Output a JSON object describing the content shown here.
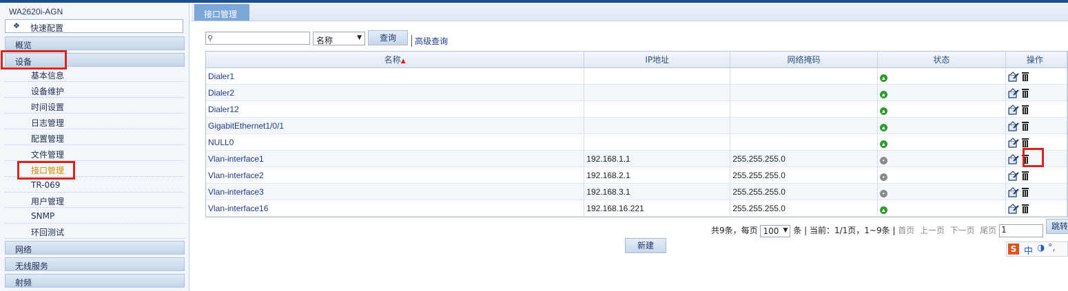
{
  "device_model": "WA2620i-AGN",
  "sidebar": {
    "quick_config": "快速配置",
    "sections_top": [
      "概览",
      "设备"
    ],
    "device_items": [
      "基本信息",
      "设备维护",
      "时间设置",
      "日志管理",
      "配置管理",
      "文件管理",
      "接口管理",
      "TR-069",
      "用户管理",
      "SNMP",
      "环回测试"
    ],
    "active_item": "接口管理",
    "sections_bottom": [
      "网络",
      "无线服务",
      "射频"
    ]
  },
  "tab": {
    "label": "接口管理"
  },
  "search": {
    "field_value": "名称",
    "query_button": "查询",
    "advanced_link": "高级查询"
  },
  "table": {
    "columns": [
      "名称",
      "IP地址",
      "网络掩码",
      "状态",
      "操作"
    ],
    "rows": [
      {
        "name": "Dialer1",
        "ip": "",
        "mask": "",
        "status": "up"
      },
      {
        "name": "Dialer2",
        "ip": "",
        "mask": "",
        "status": "up"
      },
      {
        "name": "Dialer12",
        "ip": "",
        "mask": "",
        "status": "up"
      },
      {
        "name": "GigabitEthernet1/0/1",
        "ip": "",
        "mask": "",
        "status": "up"
      },
      {
        "name": "NULL0",
        "ip": "",
        "mask": "",
        "status": "up"
      },
      {
        "name": "Vlan-interface1",
        "ip": "192.168.1.1",
        "mask": "255.255.255.0",
        "status": "down"
      },
      {
        "name": "Vlan-interface2",
        "ip": "192.168.2.1",
        "mask": "255.255.255.0",
        "status": "down"
      },
      {
        "name": "Vlan-interface3",
        "ip": "192.168.3.1",
        "mask": "255.255.255.0",
        "status": "down"
      },
      {
        "name": "Vlan-interface16",
        "ip": "192.168.16.221",
        "mask": "255.255.255.0",
        "status": "up"
      }
    ]
  },
  "pager": {
    "total": "共9条，每页",
    "per_page": "100",
    "unit": "条",
    "current": "当前：1/1页，1~9条",
    "first": "首页",
    "prev": "上一页",
    "next": "下一页",
    "last": "尾页",
    "page_input": "1",
    "jump": "跳转"
  },
  "new_button": "新建",
  "ime": {
    "logo": "S",
    "mode": "中"
  },
  "colors": {
    "accent": "#7da7d9",
    "highlight": "#d9241c",
    "status_up": "#2e9b2e",
    "status_down": "#8a8a8a"
  }
}
